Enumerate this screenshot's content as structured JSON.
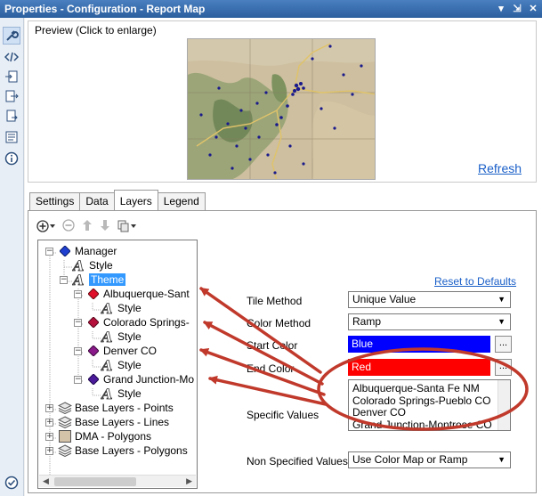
{
  "window": {
    "title": "Properties - Configuration - Report Map",
    "buttons": [
      "▾",
      "⇲",
      "✕"
    ]
  },
  "preview": {
    "label": "Preview (Click to enlarge)",
    "refresh_label": "Refresh"
  },
  "tabs": [
    {
      "label": "Settings",
      "active": false
    },
    {
      "label": "Data",
      "active": false
    },
    {
      "label": "Layers",
      "active": true
    },
    {
      "label": "Legend",
      "active": false
    }
  ],
  "tree": {
    "items": [
      {
        "label": "Manager",
        "icon": "diamond-blue-icon"
      },
      {
        "label": "Style",
        "icon": "style-a-icon"
      },
      {
        "label": "Theme",
        "icon": "style-a-icon",
        "selected": true
      },
      {
        "label": "Albuquerque-Sant",
        "icon": "diamond-red-icon"
      },
      {
        "label": "Style",
        "icon": "style-a-icon"
      },
      {
        "label": "Colorado Springs-",
        "icon": "diamond-crimson-icon"
      },
      {
        "label": "Style",
        "icon": "style-a-icon"
      },
      {
        "label": "Denver CO",
        "icon": "diamond-purple-icon"
      },
      {
        "label": "Style",
        "icon": "style-a-icon"
      },
      {
        "label": "Grand Junction-Mo",
        "icon": "diamond-darkviolet-icon"
      },
      {
        "label": "Style",
        "icon": "style-a-icon"
      },
      {
        "label": "Base Layers - Points",
        "icon": "layers-icon"
      },
      {
        "label": "Base Layers - Lines",
        "icon": "layers-icon"
      },
      {
        "label": "DMA - Polygons",
        "icon": "polygon-box-icon"
      },
      {
        "label": "Base Layers - Polygons",
        "icon": "layers-icon"
      }
    ]
  },
  "settings": {
    "reset_label": "Reset to Defaults",
    "tile_method_label": "Tile Method",
    "tile_method_value": "Unique Value",
    "color_method_label": "Color Method",
    "color_method_value": "Ramp",
    "start_color_label": "Start Color",
    "start_color_value": "Blue",
    "end_color_label": "End Color",
    "end_color_value": "Red",
    "specific_values_label": "Specific Values",
    "specific_values": [
      "Albuquerque-Santa Fe NM",
      "Colorado Springs-Pueblo CO",
      "Denver CO",
      "Grand Junction-Montrose CO"
    ],
    "non_specified_label": "Non Specified Values",
    "non_specified_value": "Use Color Map or Ramp",
    "ellipsis": "..."
  },
  "colors": {
    "start": "#0000ff",
    "end": "#ff0000",
    "annotation": "#c0392b"
  }
}
